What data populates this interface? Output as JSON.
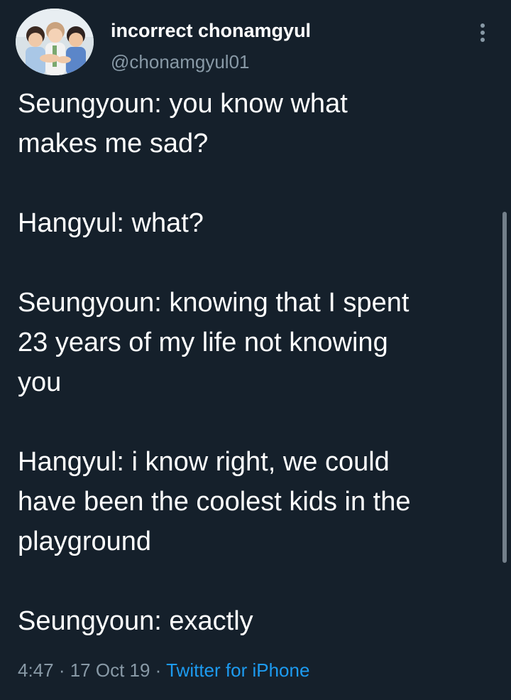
{
  "colors": {
    "background": "#15202b",
    "text": "#ffffff",
    "muted": "#8899a6",
    "link": "#1d9bf0"
  },
  "author": {
    "display_name": "incorrect chonamgyul",
    "handle": "@chonamgyul01",
    "avatar_icon": "profile-photo"
  },
  "tweet": {
    "lines": [
      "Seungyoun: you know what",
      "makes me sad?",
      "",
      "Hangyul: what?",
      "",
      "Seungyoun: knowing that I spent",
      "23 years of my life not knowing",
      "you",
      "",
      "Hangyul: i know right, we could",
      "have been the coolest kids in the",
      "playground",
      "",
      "Seungyoun: exactly"
    ]
  },
  "meta": {
    "time": "4:47",
    "sep1": " · ",
    "date": "17 Oct 19",
    "sep2": " · ",
    "source": "Twitter for iPhone"
  },
  "icons": {
    "more": "more-vertical-icon"
  }
}
